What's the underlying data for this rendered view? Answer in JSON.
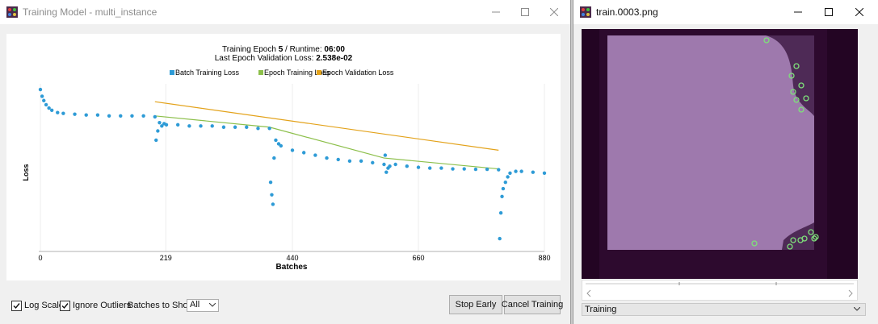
{
  "training_window": {
    "title": "Training Model - multi_instance",
    "header": {
      "line1_prefix": "Training Epoch ",
      "epoch": "5",
      "line1_mid": " / Runtime: ",
      "runtime": "06:00",
      "line2_prefix": "Last Epoch Validation Loss: ",
      "val_loss": "2.538e-02"
    },
    "controls": {
      "log_scale_label": "Log Scale",
      "log_scale_checked": true,
      "ignore_outliers_label": "Ignore Outliers",
      "ignore_outliers_checked": true,
      "batches_label": "Batches to Show:",
      "batches_value": "All",
      "stop_early_label": "Stop Early",
      "cancel_training_label": "Cancel Training"
    }
  },
  "chart_data": {
    "type": "line",
    "xlabel": "Batches",
    "ylabel": "Loss",
    "x_ticks": [
      "0",
      "219",
      "440",
      "660",
      "880"
    ],
    "xlim": [
      0,
      880
    ],
    "y_scale": "log",
    "legend_placement": "top-center",
    "series": [
      {
        "name": "Batch Training Loss",
        "type": "scatter",
        "color": "#2e9bd6",
        "points": [
          [
            0,
            0.85
          ],
          [
            3,
            0.7
          ],
          [
            6,
            0.62
          ],
          [
            10,
            0.55
          ],
          [
            15,
            0.5
          ],
          [
            20,
            0.47
          ],
          [
            30,
            0.44
          ],
          [
            40,
            0.43
          ],
          [
            60,
            0.42
          ],
          [
            80,
            0.41
          ],
          [
            100,
            0.41
          ],
          [
            120,
            0.4
          ],
          [
            140,
            0.4
          ],
          [
            160,
            0.4
          ],
          [
            180,
            0.4
          ],
          [
            200,
            0.39
          ],
          [
            202,
            0.2
          ],
          [
            205,
            0.26
          ],
          [
            208,
            0.33
          ],
          [
            212,
            0.3
          ],
          [
            216,
            0.32
          ],
          [
            220,
            0.31
          ],
          [
            240,
            0.31
          ],
          [
            260,
            0.3
          ],
          [
            280,
            0.3
          ],
          [
            300,
            0.3
          ],
          [
            320,
            0.29
          ],
          [
            340,
            0.29
          ],
          [
            360,
            0.29
          ],
          [
            380,
            0.28
          ],
          [
            400,
            0.28
          ],
          [
            402,
            0.06
          ],
          [
            404,
            0.042
          ],
          [
            406,
            0.032
          ],
          [
            408,
            0.12
          ],
          [
            411,
            0.2
          ],
          [
            416,
            0.18
          ],
          [
            420,
            0.17
          ],
          [
            440,
            0.15
          ],
          [
            460,
            0.14
          ],
          [
            480,
            0.13
          ],
          [
            500,
            0.12
          ],
          [
            520,
            0.115
          ],
          [
            540,
            0.11
          ],
          [
            560,
            0.11
          ],
          [
            580,
            0.105
          ],
          [
            600,
            0.1
          ],
          [
            602,
            0.13
          ],
          [
            604,
            0.08
          ],
          [
            607,
            0.09
          ],
          [
            610,
            0.095
          ],
          [
            620,
            0.1
          ],
          [
            640,
            0.095
          ],
          [
            660,
            0.092
          ],
          [
            680,
            0.09
          ],
          [
            700,
            0.09
          ],
          [
            720,
            0.088
          ],
          [
            740,
            0.088
          ],
          [
            760,
            0.087
          ],
          [
            780,
            0.087
          ],
          [
            800,
            0.086
          ],
          [
            802,
            0.012
          ],
          [
            804,
            0.025
          ],
          [
            806,
            0.04
          ],
          [
            808,
            0.05
          ],
          [
            812,
            0.06
          ],
          [
            816,
            0.07
          ],
          [
            820,
            0.078
          ],
          [
            830,
            0.082
          ],
          [
            840,
            0.082
          ],
          [
            860,
            0.08
          ],
          [
            880,
            0.078
          ]
        ]
      },
      {
        "name": "Epoch Training Loss",
        "type": "line",
        "color": "#8cbf4a",
        "points": [
          [
            200,
            0.4
          ],
          [
            400,
            0.29
          ],
          [
            600,
            0.12
          ],
          [
            800,
            0.088
          ]
        ]
      },
      {
        "name": "Epoch Validation Loss",
        "type": "line",
        "color": "#e3a21a",
        "points": [
          [
            200,
            0.6
          ],
          [
            800,
            0.15
          ]
        ]
      }
    ]
  },
  "image_window": {
    "title": "train.0003.png",
    "dropdown_value": "Training",
    "image_colors": {
      "background": "#230523",
      "plate": "#9e79ad",
      "marker": "#7ee07a"
    },
    "keypoints_count": 16
  },
  "icons": {
    "app_icon": "app-icon",
    "minimize": "minimize-icon",
    "maximize": "maximize-icon",
    "close": "close-icon"
  }
}
